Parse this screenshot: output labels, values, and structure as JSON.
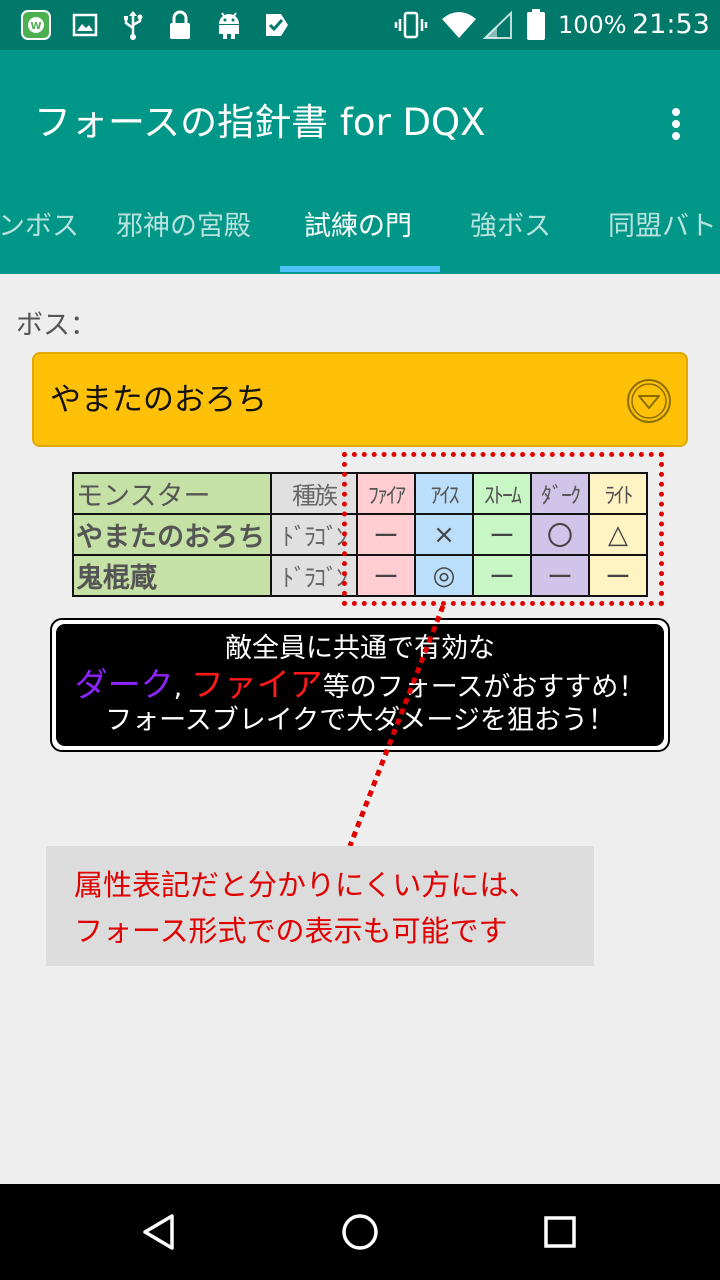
{
  "status_bar": {
    "battery": "100%",
    "time": "21:53",
    "icons": [
      "app-badge-icon",
      "image-icon",
      "usb-icon",
      "lock-icon",
      "android-icon",
      "check-icon",
      "vibrate-icon",
      "wifi-icon",
      "signal-icon",
      "battery-icon"
    ]
  },
  "app_bar": {
    "title": "フォースの指針書 for DQX",
    "menu_icon": "more-vert-icon"
  },
  "tabs": [
    {
      "label": "ンボス",
      "active": false
    },
    {
      "label": "邪神の宮殿",
      "active": false
    },
    {
      "label": "試練の門",
      "active": true
    },
    {
      "label": "強ボス",
      "active": false
    },
    {
      "label": "同盟バト",
      "active": false
    }
  ],
  "boss": {
    "label": "ボス：",
    "selected": "やまたのおろち",
    "dropdown_icon": "chevron-down-circle-icon"
  },
  "force_table": {
    "headers": [
      "モンスター",
      "種族",
      "ﾌｧｲｱ",
      "ｱｲｽ",
      "ｽﾄｰﾑ",
      "ﾀﾞｰｸ",
      "ﾗｲﾄ"
    ],
    "rows": [
      {
        "name": "やまたのおろち",
        "race": "ﾄﾞﾗｺﾞﾝ",
        "marks": [
          "ー",
          "×",
          "ー",
          "〇",
          "△"
        ]
      },
      {
        "name": "鬼棍蔵",
        "race": "ﾄﾞﾗｺﾞﾝ",
        "marks": [
          "ー",
          "◎",
          "ー",
          "ー",
          "ー"
        ]
      }
    ],
    "colors": {
      "fire": "#ffcdd2",
      "ice": "#bbdefb",
      "storm": "#c8f7c5",
      "dark": "#d1c4e9",
      "light": "#fff3c4",
      "monster": "#c5e1a5"
    }
  },
  "tip": {
    "line1": "敵全員に共通で有効な",
    "dark": "ダーク",
    "sep": ", ",
    "fire": "ファイア",
    "line2_rest": "等のフォースがおすすめ！",
    "line3": "フォースブレイクで大ダメージを狙おう！"
  },
  "note": {
    "line1": "属性表記だと分かりにくい方には、",
    "line2": "フォース形式での表示も可能です"
  },
  "nav_bar": {
    "icons": [
      "back-icon",
      "home-icon",
      "recents-icon"
    ]
  }
}
